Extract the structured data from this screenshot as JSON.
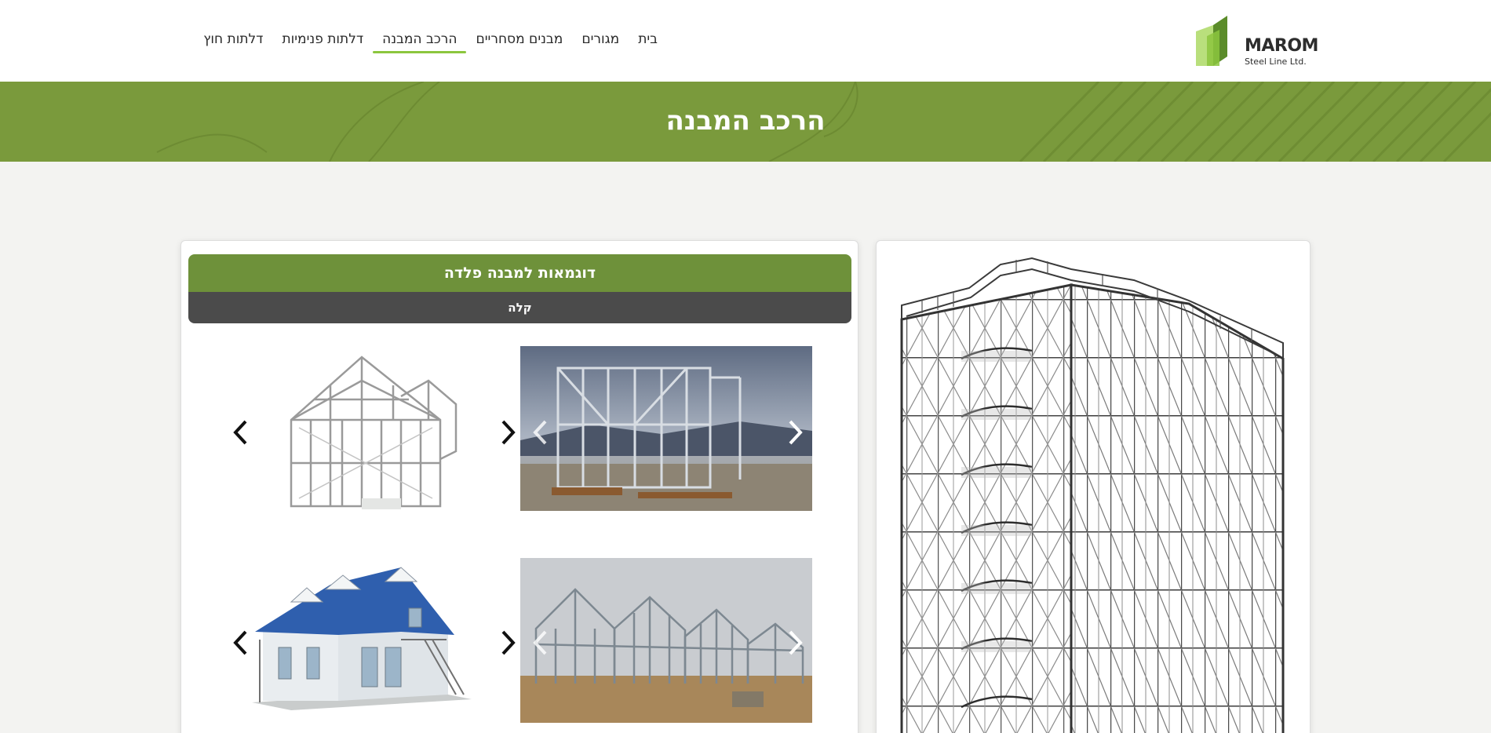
{
  "logo": {
    "name": "MAROM",
    "tagline": "Steel Line Ltd.",
    "colors": {
      "dark": "#5b8c2a",
      "light": "#b9df7c"
    }
  },
  "nav": {
    "items": [
      {
        "label": "בית",
        "active": false
      },
      {
        "label": "מגורים",
        "active": false
      },
      {
        "label": "מבנים מסחריים",
        "active": false
      },
      {
        "label": "הרכב המבנה",
        "active": true
      },
      {
        "label": "דלתות פנימיות",
        "active": false
      },
      {
        "label": "דלתות חוץ",
        "active": false
      }
    ],
    "active_underline_color": "#8cc63e"
  },
  "banner": {
    "title": "הרכב המבנה",
    "color": "#7a9a3c"
  },
  "examples": {
    "title": "דוגמאות למבנה פלדה",
    "subtitle": "קלה",
    "title_bar_color": "#6e913a",
    "sub_bar_color": "#4b4b4b",
    "galleries": [
      {
        "image": "steel-frame-construction-site-photo",
        "arrow": "chevron-right"
      },
      {
        "image": "3d-steel-frame-house-render",
        "arrow": "chevron-left"
      },
      {
        "image": "steel-frame-row-houses-photo",
        "arrow": "chevron-right"
      },
      {
        "image": "finished-house-blue-roof-render",
        "arrow": "chevron-left"
      }
    ]
  },
  "feature": {
    "image": "multi-storey-steel-frame-building-render"
  }
}
